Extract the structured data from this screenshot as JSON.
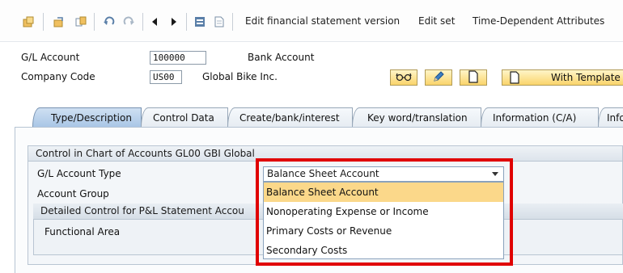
{
  "toolbar": {
    "edit_fs_version": "Edit financial statement version",
    "edit_set": "Edit set",
    "time_dependent": "Time-Dependent Attributes"
  },
  "header": {
    "gl_account_label": "G/L Account",
    "gl_account_value": "100000",
    "gl_account_desc": "Bank Account",
    "company_code_label": "Company Code",
    "company_code_value": "US00",
    "company_code_desc": "Global Bike Inc.",
    "with_template": "With Template"
  },
  "tabs": [
    {
      "label": "Type/Description"
    },
    {
      "label": "Control Data"
    },
    {
      "label": "Create/bank/interest"
    },
    {
      "label": "Key word/translation"
    },
    {
      "label": "Information (C/A)"
    },
    {
      "label": "Info"
    }
  ],
  "group": {
    "title": "Control in Chart of Accounts GL00 GBI Global",
    "gl_account_type_label": "G/L Account Type",
    "account_group_label": "Account Group",
    "pl_control_title": "Detailed Control for P&L Statement Accou",
    "functional_area_label": "Functional Area"
  },
  "dropdown": {
    "selected": "Balance Sheet Account",
    "options": [
      "Balance Sheet Account",
      "Nonoperating Expense or Income",
      "Primary Costs or Revenue",
      "Secondary Costs"
    ],
    "highlight_color": "#e00000"
  }
}
